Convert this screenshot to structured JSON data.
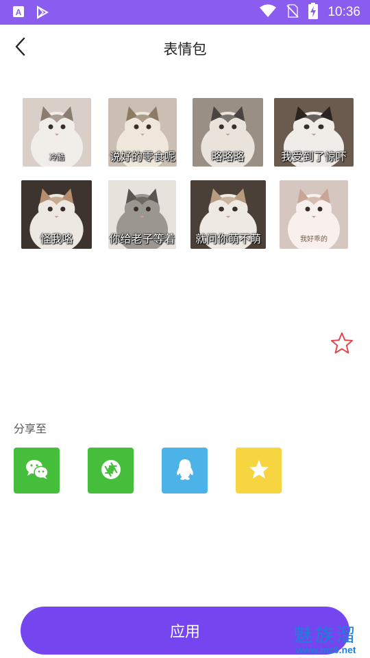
{
  "status_bar": {
    "time": "10:36",
    "icons": [
      "app-a-icon",
      "play-store-icon",
      "wifi-icon",
      "no-sim-icon",
      "battery-charging-icon"
    ],
    "background": "#8b5cf0"
  },
  "header": {
    "title": "表情包",
    "back_icon": "chevron-left-icon"
  },
  "stickers": [
    {
      "caption": "冷酷",
      "colors": [
        "#d9cfc8",
        "#f1ede8",
        "#8c7c70"
      ]
    },
    {
      "caption": "说好的零食呢",
      "colors": [
        "#cbbfb3",
        "#efe6dc",
        "#8d7a66"
      ]
    },
    {
      "caption": "略略略",
      "colors": [
        "#9a8f85",
        "#e9e3dc",
        "#4a4440"
      ]
    },
    {
      "caption": "我受到了惊吓",
      "colors": [
        "#6b5a4e",
        "#f0ece8",
        "#2b2420"
      ]
    },
    {
      "caption": "怪我咯",
      "colors": [
        "#3d342f",
        "#ede7e1",
        "#b48e6e"
      ]
    },
    {
      "caption": "你给老子等着",
      "colors": [
        "#e7e2dc",
        "#9c9690",
        "#5a5550"
      ]
    },
    {
      "caption": "就问你萌不萌",
      "colors": [
        "#4b4038",
        "#efe9e3",
        "#b99b80"
      ]
    },
    {
      "caption": "我好乖的",
      "colors": [
        "#d6c6c0",
        "#f8f0ec",
        "#c7a597"
      ]
    }
  ],
  "favorite": {
    "icon": "star-outline-icon",
    "color": "#e0474c"
  },
  "share": {
    "label": "分享至",
    "targets": [
      {
        "name": "wechat",
        "icon": "wechat-icon",
        "color": "#45be3b"
      },
      {
        "name": "moments",
        "icon": "moments-shutter-icon",
        "color": "#45be3b"
      },
      {
        "name": "qq",
        "icon": "qq-penguin-icon",
        "color": "#4bb3e8"
      },
      {
        "name": "favorites",
        "icon": "star-icon",
        "color": "#f7d540"
      }
    ]
  },
  "apply_button": {
    "label": "应用",
    "color": "#7546f0"
  },
  "watermark": {
    "name": "魅族溜",
    "url": "www.mz6.net"
  }
}
